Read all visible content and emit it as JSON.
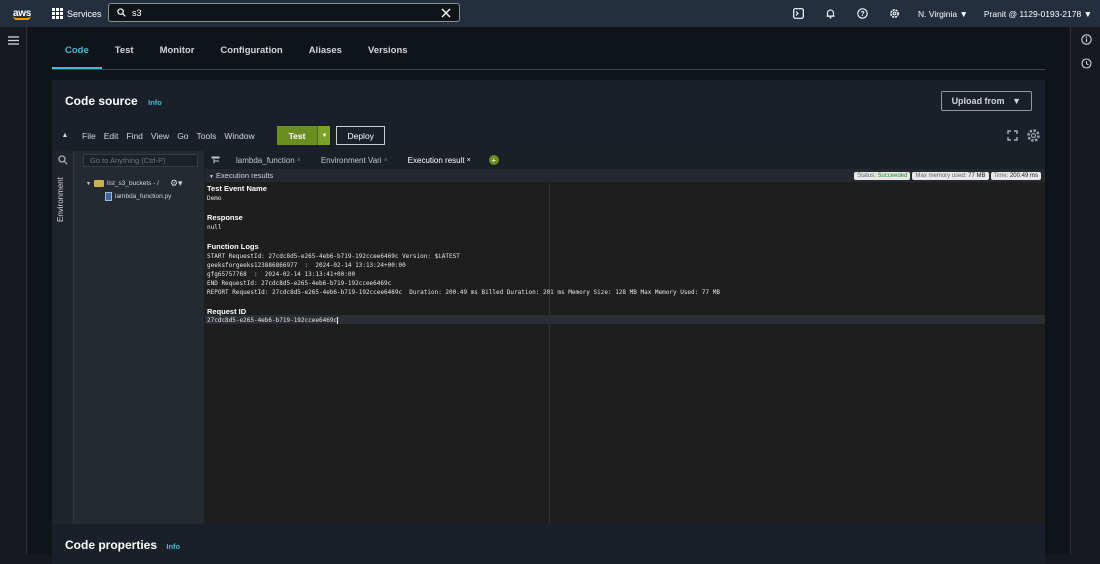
{
  "topbar": {
    "logo": "aws",
    "services_label": "Services",
    "search_value": "s3",
    "region": "N. Virginia",
    "account": "Pranit @ 1129-0193-2178"
  },
  "tabs": [
    {
      "label": "Code",
      "active": true
    },
    {
      "label": "Test",
      "active": false
    },
    {
      "label": "Monitor",
      "active": false
    },
    {
      "label": "Configuration",
      "active": false
    },
    {
      "label": "Aliases",
      "active": false
    },
    {
      "label": "Versions",
      "active": false
    }
  ],
  "code_source": {
    "title": "Code source",
    "info": "Info",
    "upload_label": "Upload from"
  },
  "toolbar": {
    "menus": [
      "File",
      "Edit",
      "Find",
      "View",
      "Go",
      "Tools",
      "Window"
    ],
    "test_label": "Test",
    "deploy_label": "Deploy"
  },
  "environment": {
    "label": "Environment",
    "goto_placeholder": "Go to Anything (Ctrl-P)",
    "folder": "list_s3_buckets - /",
    "file": "lambda_function.py"
  },
  "editor_tabs": [
    {
      "label": "lambda_function",
      "active": false
    },
    {
      "label": "Environment Vari",
      "active": false
    },
    {
      "label": "Execution result",
      "active": true
    }
  ],
  "execution": {
    "header": "Execution results",
    "status_label": "Status:",
    "status_value": "Succeeded",
    "memory_label": "Max memory used:",
    "memory_value": "77 MB",
    "time_label": "Time:",
    "time_value": "200.49 ms",
    "test_event_title": "Test Event Name",
    "test_event_value": "Demo",
    "response_title": "Response",
    "response_value": "null",
    "logs_title": "Function Logs",
    "log_lines": [
      "START RequestId: 27cdc8d5-e265-4eb6-b719-192ccee6469c Version: $LATEST",
      "geeksforgeeks123886866977  :  2024-02-14 13:13:24+00:00",
      "gfg65757768  :  2024-02-14 13:13:41+00:00",
      "END RequestId: 27cdc8d5-e265-4eb6-b719-192ccee6469c",
      "REPORT RequestId: 27cdc8d5-e265-4eb6-b719-192ccee6469c  Duration: 200.49 ms Billed Duration: 201 ms Memory Size: 128 MB Max Memory Used: 77 MB"
    ],
    "request_title": "Request ID",
    "request_value": "27cdc8d5-e265-4eb6-b719-192ccee6469c"
  },
  "code_properties": {
    "title": "Code properties",
    "info": "Info"
  }
}
